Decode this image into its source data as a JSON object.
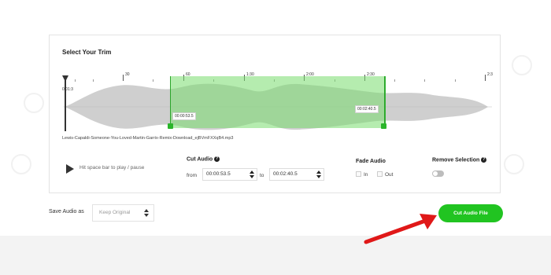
{
  "card": {
    "title": "Select Your Trim"
  },
  "ruler": {
    "labels": [
      "30",
      "60",
      "1:30",
      "2:00",
      "2:30",
      "2:3"
    ]
  },
  "waveform": {
    "playhead_time": "0:01:3",
    "selection_start_time": "00:00:53.5",
    "selection_end_time": "00:02:40.5",
    "filename": "Lewis-Capaldi-Someone-You-Loved-Martin-Garrix-Remix-Download_ejBVmFXXqB4.mp3"
  },
  "player": {
    "hint": "Hit space bar to play / pause"
  },
  "cut_audio": {
    "label": "Cut Audio",
    "from_label": "from",
    "from_value": "00:00:53.5",
    "to_label": "to",
    "to_value": "00:02:40.5"
  },
  "fade_audio": {
    "label": "Fade Audio",
    "in_label": "In",
    "out_label": "Out",
    "in_checked": false,
    "out_checked": false
  },
  "remove_selection": {
    "label": "Remove Selection",
    "enabled": false
  },
  "save": {
    "label": "Save Audio as",
    "selected": "Keep Original"
  },
  "action": {
    "cut_button": "Cut Audio File"
  },
  "colors": {
    "accent": "#21c421",
    "selection": "#7fdc6e",
    "arrow": "#e01818",
    "wave": "#cfcfcf",
    "wave_selected": "#6fb868"
  }
}
